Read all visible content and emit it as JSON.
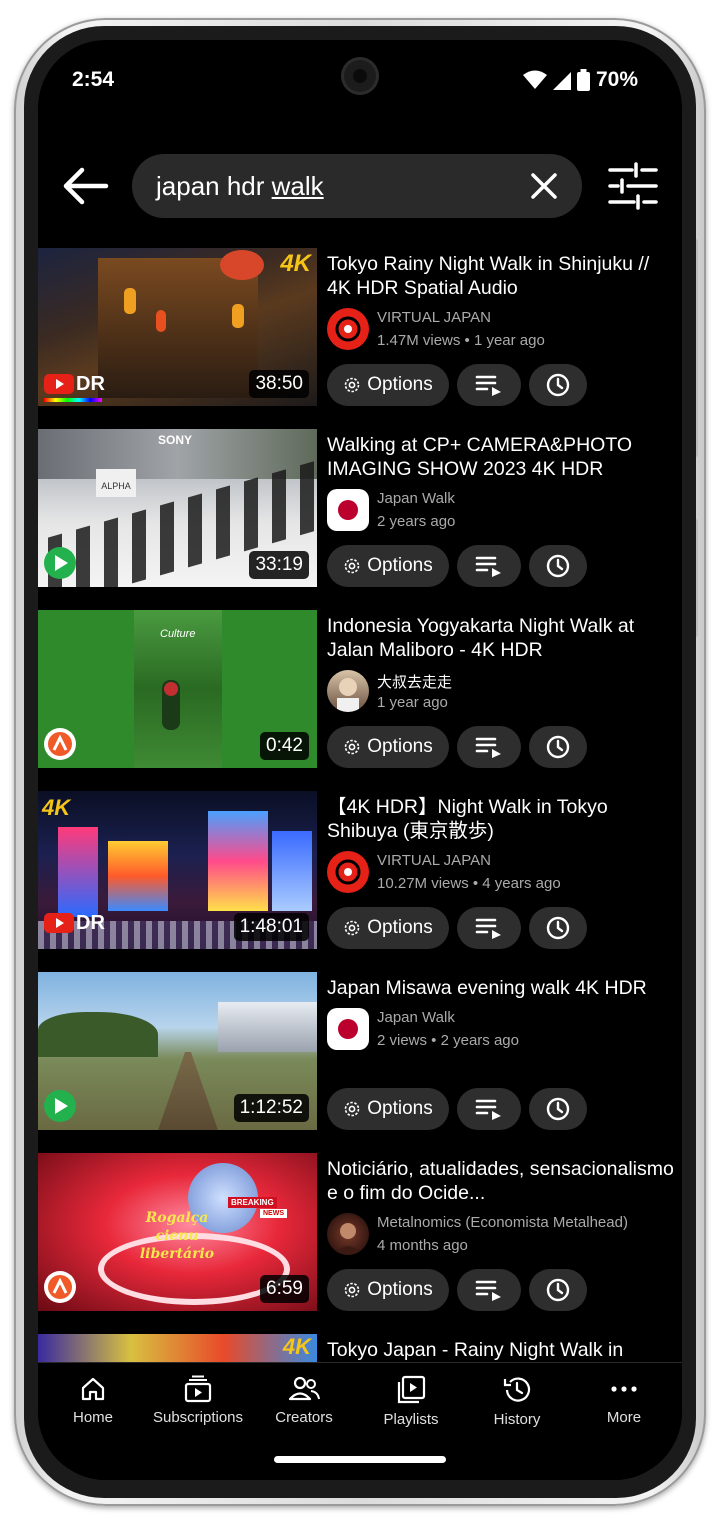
{
  "status": {
    "time": "2:54",
    "battery": "70%"
  },
  "search": {
    "query_part1": "japan hdr ",
    "query_part2": "walk"
  },
  "results": [
    {
      "title": "Tokyo Rainy Night Walk in Shinjuku // 4K HDR Spatial Audio",
      "channel": "VIRTUAL JAPAN",
      "meta": "1.47M views • 1 year ago",
      "duration": "38:50",
      "options": "Options"
    },
    {
      "title": "Walking at CP+ CAMERA&PHOTO IMAGING SHOW 2023 4K HDR",
      "channel": "Japan Walk",
      "meta": "2 years ago",
      "duration": "33:19",
      "options": "Options"
    },
    {
      "title": "Indonesia Yogyakarta Night Walk at Jalan Maliboro - 4K HDR",
      "channel": "大叔去走走",
      "meta": "1 year ago",
      "duration": "0:42",
      "options": "Options"
    },
    {
      "title": "【4K HDR】Night Walk in Tokyo Shibuya (東京散歩)",
      "channel": "VIRTUAL JAPAN",
      "meta": "10.27M views • 4 years ago",
      "duration": "1:48:01",
      "options": "Options"
    },
    {
      "title": "Japan Misawa evening walk 4K HDR",
      "channel": "Japan Walk",
      "meta": "2 views • 2 years ago",
      "duration": "1:12:52",
      "options": "Options"
    },
    {
      "title": "Noticiário, atualidades, sensacionalismo e o fim do Ocide...",
      "channel": "Metalnomics (Economista Metalhead)",
      "meta": "4 months ago",
      "duration": "6:59",
      "options": "Options"
    },
    {
      "title": "Tokyo Japan - Rainy Night Walk in"
    }
  ],
  "thumb_text": {
    "tag_4k": "4K",
    "hdr": "DR",
    "sony": "SONY",
    "alpha": "ALPHA",
    "culture": "Culture",
    "breaking": "BREAKING",
    "news": "NEWS",
    "fancy": "Rogalça cienu libertário"
  },
  "nav": [
    "Home",
    "Subscriptions",
    "Creators",
    "Playlists",
    "History",
    "More"
  ],
  "colors": {
    "background": "#000000",
    "surface": "#2a2a2a",
    "red": "#e62117",
    "muted": "#aaaaaa"
  }
}
